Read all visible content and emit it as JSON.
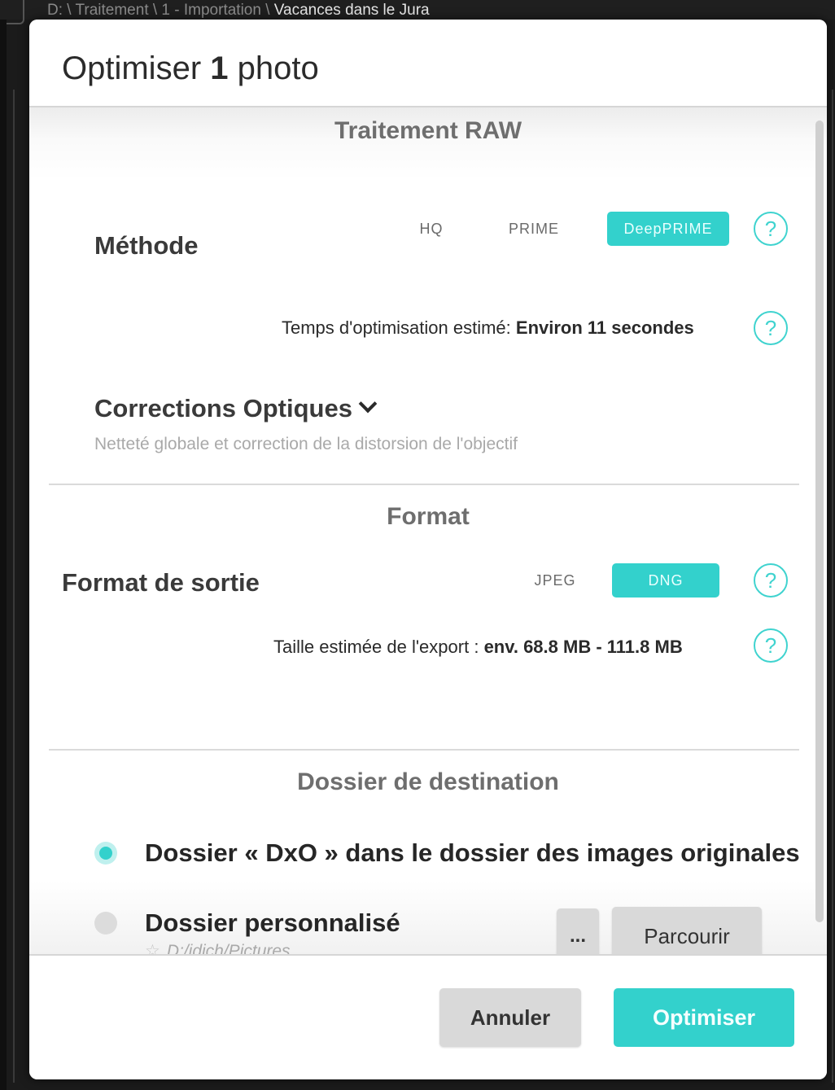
{
  "background": {
    "breadcrumb": {
      "path_prefix": "D: \\ Traitement \\ 1 - Importation \\ ",
      "current": "Vacances dans le Jura"
    }
  },
  "dialog": {
    "title_prefix": "Optimiser ",
    "title_count": "1",
    "title_suffix": " photo"
  },
  "raw": {
    "section_title": "Traitement RAW",
    "method_label": "Méthode",
    "method_options": [
      "HQ",
      "PRIME",
      "DeepPRIME"
    ],
    "method_selected": "DeepPRIME",
    "estimate_label": "Temps d'optimisation estimé:",
    "estimate_value": "Environ 11 secondes",
    "corrections_label": "Corrections Optiques",
    "corrections_desc": "Netteté globale et correction de la distorsion de l'objectif"
  },
  "format": {
    "section_title": "Format",
    "output_label": "Format de sortie",
    "options": [
      "JPEG",
      "DNG"
    ],
    "selected": "DNG",
    "size_label": "Taille estimée de l'export :",
    "size_value": "env. 68.8 MB - 111.8 MB"
  },
  "destination": {
    "section_title": "Dossier de destination",
    "option_dxo": "Dossier « DxO » dans le dossier des images originales",
    "option_custom": "Dossier personnalisé",
    "custom_path": "D:/jdich/Pictures",
    "dots_button": "...",
    "browse_button": "Parcourir",
    "selected": "dxo"
  },
  "footer": {
    "cancel": "Annuler",
    "confirm": "Optimiser"
  },
  "colors": {
    "accent": "#33d1cc",
    "accent_text": "#eafffe",
    "section_title": "#6e6e6e"
  },
  "icons": {
    "help": "help-circle-icon",
    "chevron": "chevron-down-icon",
    "star": "star-outline-icon"
  }
}
